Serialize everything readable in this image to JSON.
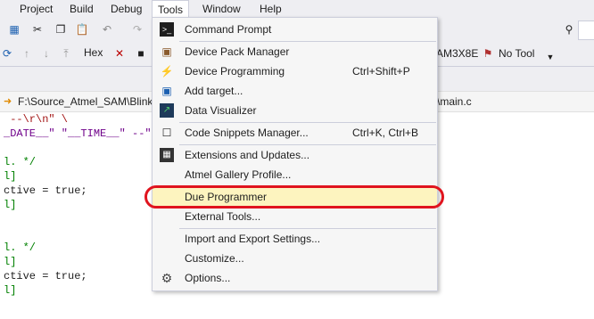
{
  "menubar": {
    "items": [
      "Project",
      "Build",
      "Debug",
      "Tools",
      "Window",
      "Help"
    ]
  },
  "toolbar": {
    "hex_label": "Hex",
    "device_text": "AM3X8E",
    "no_tool_label": "No Tool"
  },
  "pathbar": {
    "left_text": "F:\\Source_Atmel_SAM\\Blink",
    "right_text": "\\main.c"
  },
  "code_lines": [
    " --\\r\\n\" \\",
    "_DATE__\" \"__TIME__\" --\"ST",
    "",
    "l. */",
    "l]",
    "ctive = true;",
    "l]",
    "",
    "",
    "l. */",
    "l]",
    "ctive = true;",
    "l]"
  ],
  "tools_menu": {
    "items": [
      {
        "label": "Command Prompt",
        "shortcut": "",
        "icon": "command-prompt-icon"
      },
      {
        "label": "Device Pack Manager",
        "shortcut": "",
        "icon": "pack-icon"
      },
      {
        "label": "Device Programming",
        "shortcut": "Ctrl+Shift+P",
        "icon": "lightning-icon"
      },
      {
        "label": "Add target...",
        "shortcut": "",
        "icon": "add-target-icon"
      },
      {
        "label": "Data Visualizer",
        "shortcut": "",
        "icon": "chart-icon"
      },
      {
        "label": "Code Snippets Manager...",
        "shortcut": "Ctrl+K, Ctrl+B",
        "icon": "snippet-icon"
      },
      {
        "label": "Extensions and Updates...",
        "shortcut": "",
        "icon": "extensions-icon"
      },
      {
        "label": "Atmel Gallery Profile...",
        "shortcut": "",
        "icon": ""
      },
      {
        "label": "Due Programmer",
        "shortcut": "",
        "icon": ""
      },
      {
        "label": "External Tools...",
        "shortcut": "",
        "icon": ""
      },
      {
        "label": "Import and Export Settings...",
        "shortcut": "",
        "icon": ""
      },
      {
        "label": "Customize...",
        "shortcut": "",
        "icon": ""
      },
      {
        "label": "Options...",
        "shortcut": "",
        "icon": "gear-icon"
      }
    ]
  },
  "colors": {
    "highlight": "#fdf4bf",
    "annotation_red": "#e0141e"
  }
}
